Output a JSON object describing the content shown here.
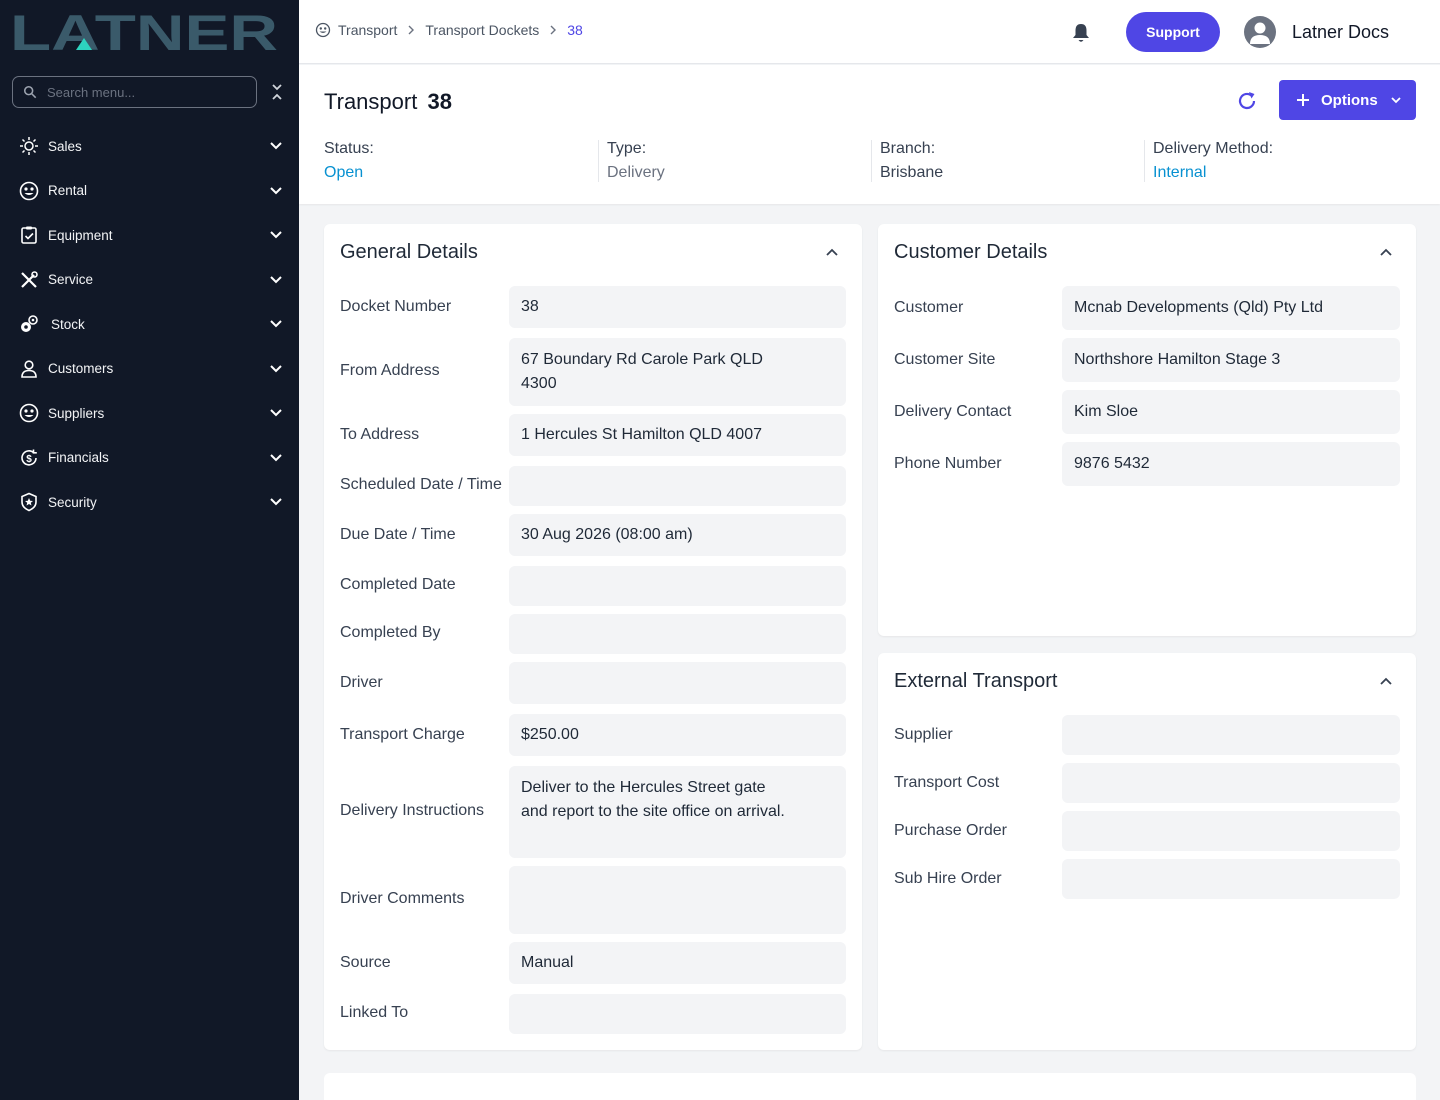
{
  "brand": {
    "name": "LATNER"
  },
  "sidebar": {
    "search_placeholder": "Search menu...",
    "items": [
      {
        "label": "Sales",
        "icon": "sales-icon"
      },
      {
        "label": "Rental",
        "icon": "rental-icon"
      },
      {
        "label": "Equipment",
        "icon": "equipment-icon"
      },
      {
        "label": "Service",
        "icon": "service-icon"
      },
      {
        "label": "Stock",
        "icon": "stock-icon"
      },
      {
        "label": "Customers",
        "icon": "customers-icon"
      },
      {
        "label": "Suppliers",
        "icon": "suppliers-icon"
      },
      {
        "label": "Financials",
        "icon": "financials-icon"
      },
      {
        "label": "Security",
        "icon": "security-icon"
      }
    ]
  },
  "topbar": {
    "breadcrumb": [
      "Transport",
      "Transport Dockets",
      "38"
    ],
    "support_label": "Support",
    "user_name": "Latner Docs"
  },
  "header": {
    "title": "Transport",
    "number": "38",
    "options_label": "Options",
    "stats": [
      {
        "label": "Status:",
        "value": "Open"
      },
      {
        "label": "Type:",
        "value": "Delivery"
      },
      {
        "label": "Branch:",
        "value": "Brisbane"
      },
      {
        "label": "Delivery Method:",
        "value": "Internal"
      }
    ]
  },
  "general": {
    "title": "General Details",
    "fields": [
      {
        "label": "Docket Number",
        "value": "38"
      },
      {
        "label": "From Address",
        "value": "67 Boundary Rd Carole Park QLD 4300"
      },
      {
        "label": "To Address",
        "value": "1 Hercules St Hamilton QLD 4007"
      },
      {
        "label": "Scheduled Date / Time",
        "value": ""
      },
      {
        "label": "Due Date / Time",
        "value": "30 Aug 2026 (08:00 am)"
      },
      {
        "label": "Completed Date",
        "value": ""
      },
      {
        "label": "Completed By",
        "value": ""
      },
      {
        "label": "Driver",
        "value": ""
      },
      {
        "label": "Transport Charge",
        "value": "$250.00"
      },
      {
        "label": "Delivery Instructions",
        "value": "Deliver to the Hercules Street gate and report to the site office on arrival."
      },
      {
        "label": "Driver Comments",
        "value": ""
      },
      {
        "label": "Source",
        "value": "Manual"
      },
      {
        "label": "Linked To",
        "value": ""
      }
    ]
  },
  "customer": {
    "title": "Customer Details",
    "fields": [
      {
        "label": "Customer",
        "value": "Mcnab Developments (Qld) Pty Ltd"
      },
      {
        "label": "Customer Site",
        "value": "Northshore Hamilton Stage 3"
      },
      {
        "label": "Delivery Contact",
        "value": "Kim Sloe"
      },
      {
        "label": "Phone Number",
        "value": "9876 5432"
      }
    ]
  },
  "external": {
    "title": "External Transport",
    "fields": [
      {
        "label": "Supplier",
        "value": ""
      },
      {
        "label": "Transport Cost",
        "value": ""
      },
      {
        "label": "Purchase Order",
        "value": ""
      },
      {
        "label": "Sub Hire Order",
        "value": ""
      }
    ]
  }
}
